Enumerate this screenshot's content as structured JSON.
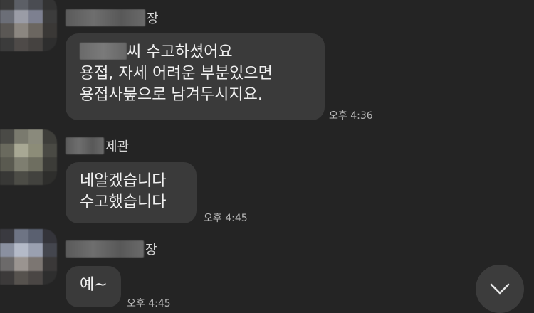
{
  "messages": [
    {
      "sender_suffix": "장",
      "lines": [
        "씨 수고하셨어요",
        "용접, 자세 어려운 부분있으면",
        "용접사뭎으로 남겨두시지요."
      ],
      "time": "오후 4:36"
    },
    {
      "sender_suffix": "제관",
      "lines": [
        "네알겠습니다",
        "수고했습니다"
      ],
      "time": "오후 4:45"
    },
    {
      "sender_suffix": "장",
      "lines": [
        "예~"
      ],
      "time": "오후 4:45"
    }
  ],
  "scroll_button": {
    "icon": "chevron-down-icon"
  },
  "colors": {
    "background": "#242424",
    "bubble": "#3a3a3a",
    "text": "#f0f0f0",
    "timestamp": "#b8b8b8"
  }
}
